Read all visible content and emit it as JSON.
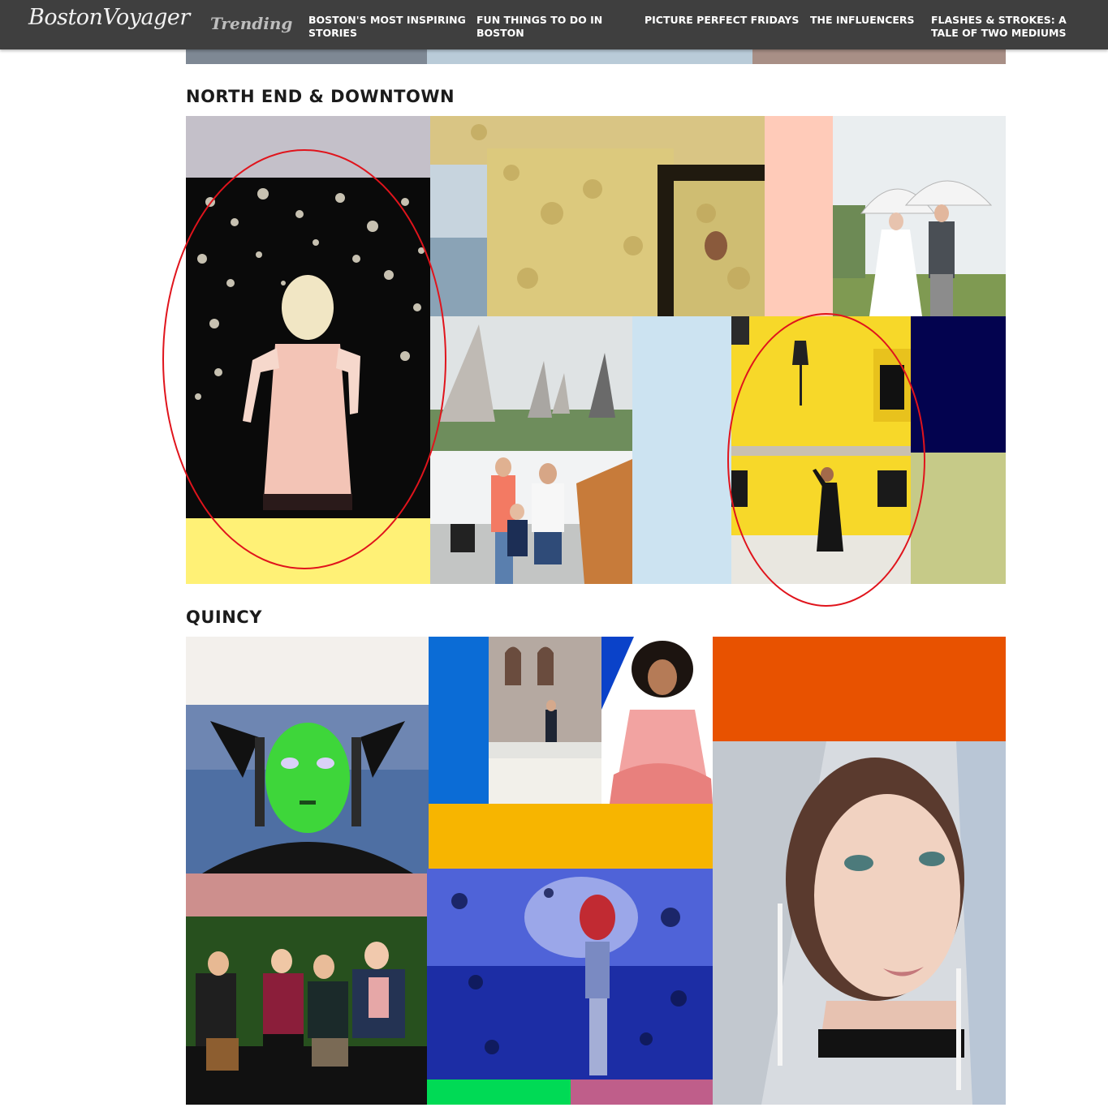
{
  "nav": {
    "brand": "BostonVoyager",
    "trending_label": "Trending",
    "links": [
      {
        "line1": "BOSTON'S MOST INSPIRING",
        "line2": "STORIES"
      },
      {
        "line1": "FUN THINGS TO DO IN",
        "line2": "BOSTON"
      },
      {
        "line1": "PICTURE PERFECT FRIDAYS",
        "line2": ""
      },
      {
        "line1": "THE INFLUENCERS",
        "line2": ""
      },
      {
        "line1": "FLASHES & STROKES: A",
        "line2": "TALE OF TWO MEDIUMS"
      }
    ]
  },
  "sections": [
    {
      "title": "NORTH END & DOWNTOWN"
    },
    {
      "title": "QUINCY"
    }
  ],
  "colors": {
    "nav_bg": "#3f3f3f",
    "annotation": "#e0141c",
    "lavender": "#c4c0c9",
    "yellow": "#fff176",
    "peach": "#ffcbb9",
    "light_blue": "#cce3f1",
    "navy": "#03034f",
    "sage": "#c6ca88",
    "off_white": "#f3f0ec",
    "royal_blue": "#0b6cd6",
    "gold": "#f7b500",
    "orange": "#e85200",
    "dusty_rose": "#cd8f8d",
    "green": "#00da55",
    "magenta": "#bf5e8a"
  },
  "icons": [
    "photo-woman-blossoms",
    "photo-sponge-wall",
    "photo-wedding-umbrellas",
    "photo-sails-fog",
    "photo-family-pier",
    "photo-yellow-building",
    "photo-green-mask",
    "photo-church-portrait",
    "photo-curly-hair-dress",
    "photo-band-group",
    "photo-blue-figure",
    "photo-woman-earrings"
  ]
}
